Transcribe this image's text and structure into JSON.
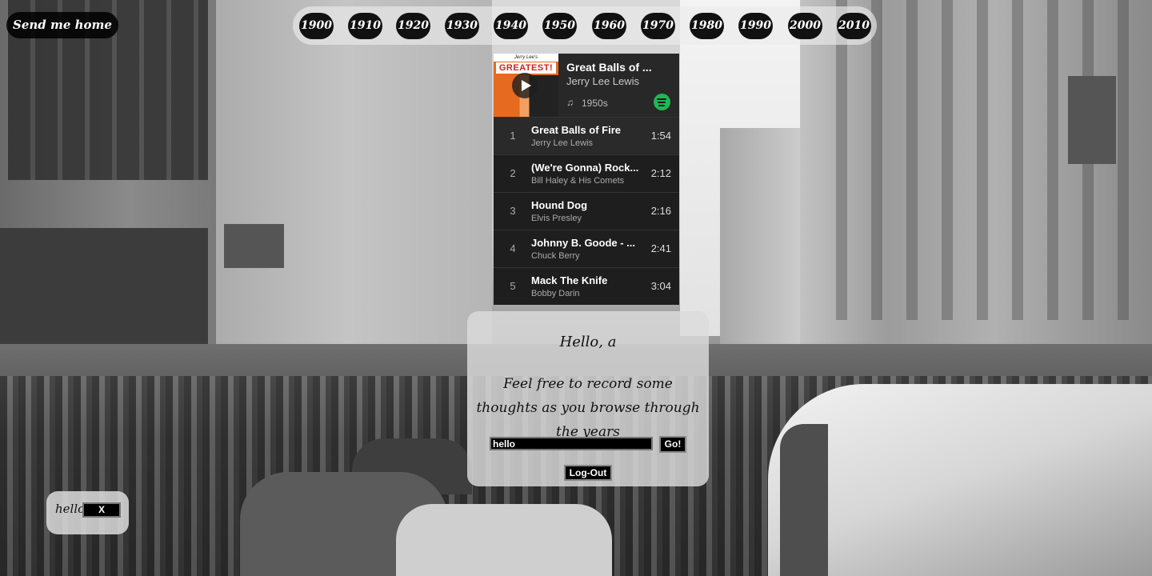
{
  "nav": {
    "home_label": "Send me home",
    "decades": [
      "1900",
      "1910",
      "1920",
      "1930",
      "1940",
      "1950",
      "1960",
      "1970",
      "1980",
      "1990",
      "2000",
      "2010"
    ]
  },
  "player": {
    "cover_top_text": "Jerry Lee's",
    "cover_title": "GREATEST!",
    "now_playing_title": "Great Balls of ...",
    "now_playing_artist": "Jerry Lee Lewis",
    "note_icon": "♫",
    "era": "1950s",
    "brand_color": "#1db954",
    "tracks": [
      {
        "num": "1",
        "title": "Great Balls of Fire",
        "artist": "Jerry Lee Lewis",
        "duration": "1:54"
      },
      {
        "num": "2",
        "title": "(We're Gonna) Rock...",
        "artist": "Bill Haley & His Comets",
        "duration": "2:12"
      },
      {
        "num": "3",
        "title": "Hound Dog",
        "artist": "Elvis Presley",
        "duration": "2:16"
      },
      {
        "num": "4",
        "title": "Johnny B. Goode - ...",
        "artist": "Chuck Berry",
        "duration": "2:41"
      },
      {
        "num": "5",
        "title": "Mack The Knife",
        "artist": "Bobby Darin",
        "duration": "3:04"
      }
    ]
  },
  "panel": {
    "greeting": "Hello, a",
    "invite": "Feel free to record some thoughts as you browse through the years",
    "input_value": "hello",
    "go_label": "Go!",
    "logout_label": "Log-Out"
  },
  "thought": {
    "text": "hello",
    "delete_label": "X"
  }
}
